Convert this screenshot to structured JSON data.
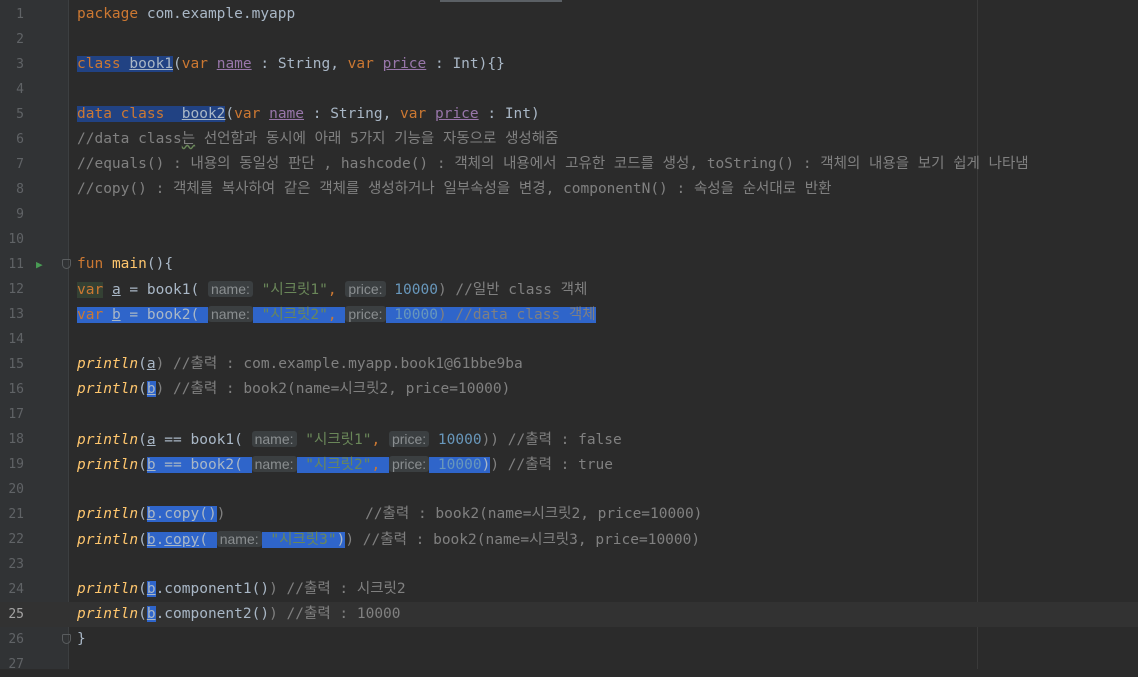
{
  "editor": {
    "current_line": 25,
    "lines": [
      {
        "n": "1",
        "segs": [
          {
            "t": "package",
            "c": "kw"
          },
          {
            "t": " com.example.myapp",
            "c": "txt"
          }
        ]
      },
      {
        "n": "2",
        "segs": []
      },
      {
        "n": "3",
        "segs": [
          {
            "t": "class",
            "c": "kw sel"
          },
          {
            "t": " ",
            "c": "txt sel"
          },
          {
            "t": "book1",
            "c": "txt sel ul"
          },
          {
            "t": "(",
            "c": "txt"
          },
          {
            "t": "var",
            "c": "kw"
          },
          {
            "t": " ",
            "c": "txt"
          },
          {
            "t": "name",
            "c": "prop"
          },
          {
            "t": " : String, ",
            "c": "txt"
          },
          {
            "t": "var",
            "c": "kw"
          },
          {
            "t": " ",
            "c": "txt"
          },
          {
            "t": "price",
            "c": "prop"
          },
          {
            "t": " : Int){}",
            "c": "txt"
          }
        ]
      },
      {
        "n": "4",
        "segs": []
      },
      {
        "n": "5",
        "segs": [
          {
            "t": "data class  ",
            "c": "kw sel"
          },
          {
            "t": "book2",
            "c": "txt sel ul"
          },
          {
            "t": "(",
            "c": "txt"
          },
          {
            "t": "var",
            "c": "kw"
          },
          {
            "t": " ",
            "c": "txt"
          },
          {
            "t": "name",
            "c": "prop"
          },
          {
            "t": " : String, ",
            "c": "txt"
          },
          {
            "t": "var",
            "c": "kw"
          },
          {
            "t": " ",
            "c": "txt"
          },
          {
            "t": "price",
            "c": "prop"
          },
          {
            "t": " : Int)",
            "c": "txt"
          }
        ]
      },
      {
        "n": "6",
        "segs": [
          {
            "t": "//data class",
            "c": "cmt"
          },
          {
            "t": "는",
            "c": "cmt wave"
          },
          {
            "t": " 선언함과 동시에 아래 5가지 기능을 자동으로 생성해줌",
            "c": "cmt"
          }
        ]
      },
      {
        "n": "7",
        "segs": [
          {
            "t": "//equals() : 내용의 동일성 판단 , hashcode() : 객체의 내용에서 고유한 코드를 생성, toString() : 객체의 내용을 보기 쉽게 나타냄",
            "c": "cmt"
          }
        ]
      },
      {
        "n": "8",
        "segs": [
          {
            "t": "//copy() : 객체를 복사하여 같은 객체를 생성하거나 일부속성을 변경, componentN() : 속성을 순서대로 반환",
            "c": "cmt"
          }
        ]
      },
      {
        "n": "9",
        "segs": []
      },
      {
        "n": "10",
        "segs": []
      },
      {
        "n": "11",
        "run": true,
        "fold": true,
        "segs": [
          {
            "t": "fun",
            "c": "kw"
          },
          {
            "t": " ",
            "c": "txt"
          },
          {
            "t": "main",
            "c": "fn"
          },
          {
            "t": "(){",
            "c": "txt"
          }
        ]
      },
      {
        "n": "12",
        "segs": [
          {
            "t": "var",
            "c": "kw selw"
          },
          {
            "t": " ",
            "c": "txt"
          },
          {
            "t": "a",
            "c": "txt ul"
          },
          {
            "t": " = book1( ",
            "c": "txt"
          },
          {
            "t": "name:",
            "c": "hint"
          },
          {
            "t": " ",
            "c": "txt"
          },
          {
            "t": "\"시크릿1\"",
            "c": "str"
          },
          {
            "t": ", ",
            "c": "kw"
          },
          {
            "t": "price:",
            "c": "hint"
          },
          {
            "t": " ",
            "c": "txt"
          },
          {
            "t": "10000",
            "c": "num"
          },
          {
            "t": ") //일반 class 객체",
            "c": "cmt"
          }
        ]
      },
      {
        "n": "13",
        "segs": [
          {
            "t": "var",
            "c": "kw selb"
          },
          {
            "t": " ",
            "c": "txt selb"
          },
          {
            "t": "b",
            "c": "txt ul selb"
          },
          {
            "t": " = book2( ",
            "c": "txt selb"
          },
          {
            "t": "name:",
            "c": "hint"
          },
          {
            "t": " ",
            "c": "txt selb"
          },
          {
            "t": "\"시크릿2\"",
            "c": "str selb"
          },
          {
            "t": ", ",
            "c": "kw selb"
          },
          {
            "t": "price:",
            "c": "hint"
          },
          {
            "t": " ",
            "c": "txt selb"
          },
          {
            "t": "10000",
            "c": "num selb"
          },
          {
            "t": ") //data class 객체",
            "c": "cmt selb"
          }
        ]
      },
      {
        "n": "14",
        "segs": []
      },
      {
        "n": "15",
        "segs": [
          {
            "t": "println",
            "c": "fnit"
          },
          {
            "t": "(",
            "c": "txt"
          },
          {
            "t": "a",
            "c": "txt ul"
          },
          {
            "t": ") //출력 : com.example.myapp.book1@61bbe9ba",
            "c": "cmt"
          }
        ]
      },
      {
        "n": "16",
        "segs": [
          {
            "t": "println",
            "c": "fnit"
          },
          {
            "t": "(",
            "c": "txt"
          },
          {
            "t": "b",
            "c": "txt ul selb"
          },
          {
            "t": ") //출력 : book2(name=시크릿2, price=10000)",
            "c": "cmt"
          }
        ]
      },
      {
        "n": "17",
        "segs": []
      },
      {
        "n": "18",
        "segs": [
          {
            "t": "println",
            "c": "fnit"
          },
          {
            "t": "(",
            "c": "txt"
          },
          {
            "t": "a",
            "c": "txt ul"
          },
          {
            "t": " == book1( ",
            "c": "txt"
          },
          {
            "t": "name:",
            "c": "hint"
          },
          {
            "t": " ",
            "c": "txt"
          },
          {
            "t": "\"시크릿1\"",
            "c": "str"
          },
          {
            "t": ", ",
            "c": "kw"
          },
          {
            "t": "price:",
            "c": "hint"
          },
          {
            "t": " ",
            "c": "txt"
          },
          {
            "t": "10000",
            "c": "num"
          },
          {
            "t": ")) //출력 : false",
            "c": "cmt"
          }
        ]
      },
      {
        "n": "19",
        "segs": [
          {
            "t": "println",
            "c": "fnit"
          },
          {
            "t": "(",
            "c": "txt"
          },
          {
            "t": "b",
            "c": "txt ul selb"
          },
          {
            "t": " == book2( ",
            "c": "txt selb"
          },
          {
            "t": "name:",
            "c": "hint"
          },
          {
            "t": " ",
            "c": "txt selb"
          },
          {
            "t": "\"시크릿2\"",
            "c": "str selb"
          },
          {
            "t": ", ",
            "c": "kw selb"
          },
          {
            "t": "price:",
            "c": "hint"
          },
          {
            "t": " ",
            "c": "txt selb"
          },
          {
            "t": "10000",
            "c": "num selb"
          },
          {
            "t": ")",
            "c": "txt selb"
          },
          {
            "t": ") //출력 : true",
            "c": "cmt"
          }
        ]
      },
      {
        "n": "20",
        "segs": []
      },
      {
        "n": "21",
        "segs": [
          {
            "t": "println",
            "c": "fnit"
          },
          {
            "t": "(",
            "c": "txt"
          },
          {
            "t": "b",
            "c": "txt ul selb"
          },
          {
            "t": ".copy()",
            "c": "txt selb"
          },
          {
            "t": ")                //출력 : book2(name=시크릿2, price=10000)",
            "c": "cmt"
          }
        ]
      },
      {
        "n": "22",
        "segs": [
          {
            "t": "println",
            "c": "fnit"
          },
          {
            "t": "(",
            "c": "txt"
          },
          {
            "t": "b",
            "c": "txt ul selb"
          },
          {
            "t": ".",
            "c": "txt selb"
          },
          {
            "t": "copy",
            "c": "txt ul selb"
          },
          {
            "t": "( ",
            "c": "txt selb"
          },
          {
            "t": "name:",
            "c": "hint"
          },
          {
            "t": " ",
            "c": "txt selb"
          },
          {
            "t": "\"시크릿3\"",
            "c": "str selb"
          },
          {
            "t": ")",
            "c": "txt selb"
          },
          {
            "t": ") //출력 : book2(name=시크릿3, price=10000)",
            "c": "cmt"
          }
        ]
      },
      {
        "n": "23",
        "segs": []
      },
      {
        "n": "24",
        "segs": [
          {
            "t": "println",
            "c": "fnit"
          },
          {
            "t": "(",
            "c": "txt"
          },
          {
            "t": "b",
            "c": "txt ul selb"
          },
          {
            "t": ".component1()",
            "c": "txt"
          },
          {
            "t": ") //출력 : 시크릿2",
            "c": "cmt"
          }
        ]
      },
      {
        "n": "25",
        "segs": [
          {
            "t": "println",
            "c": "fnit"
          },
          {
            "t": "(",
            "c": "txt"
          },
          {
            "t": "b",
            "c": "txt ul selb"
          },
          {
            "t": ".component2()",
            "c": "txt"
          },
          {
            "t": ") //출력 : 10000",
            "c": "cmt"
          }
        ]
      },
      {
        "n": "26",
        "fold": true,
        "segs": [
          {
            "t": "}",
            "c": "txt"
          }
        ]
      },
      {
        "n": "27",
        "segs": []
      }
    ]
  }
}
